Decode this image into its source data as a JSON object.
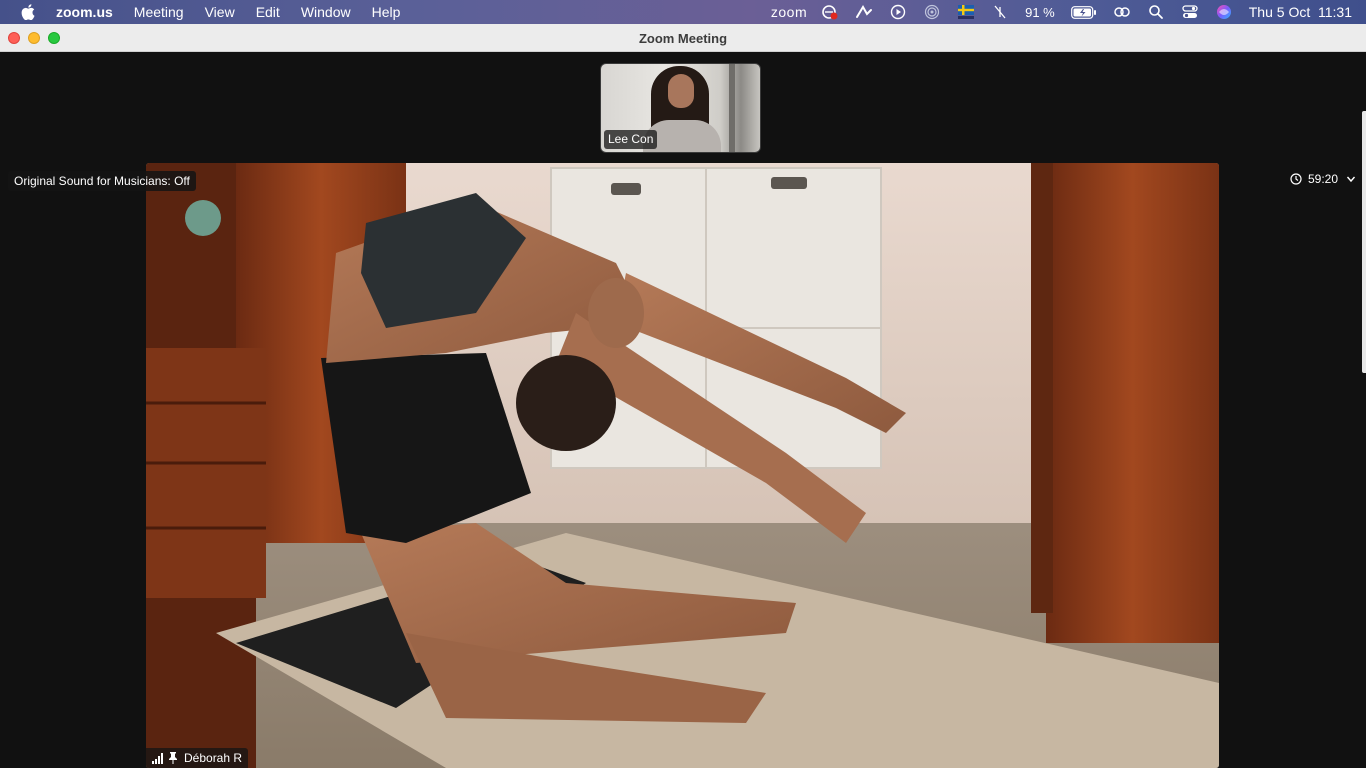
{
  "menubar": {
    "app_name": "zoom.us",
    "items": [
      "Meeting",
      "View",
      "Edit",
      "Window",
      "Help"
    ],
    "zoom_word": "zoom",
    "battery": "91 %",
    "date": "Thu 5 Oct",
    "time": "11:31",
    "icons": [
      "apple-icon",
      "zoom-recording-icon",
      "stylus-icon",
      "play-icon",
      "airdrop-icon",
      "flag-sweden-icon",
      "focus-off-icon",
      "battery-icon",
      "link-icon",
      "search-icon",
      "control-center-icon",
      "siri-icon"
    ]
  },
  "window": {
    "title": "Zoom Meeting"
  },
  "meeting": {
    "thumbnail_name": "Lee Con",
    "sound_label": "Original Sound for Musicians: Off",
    "timer": "59:20",
    "main_participant": "Déborah R"
  },
  "colors": {
    "background": "#111111",
    "traffic_close": "#fe5f57",
    "traffic_min": "#febc2e",
    "traffic_max": "#28c840"
  }
}
